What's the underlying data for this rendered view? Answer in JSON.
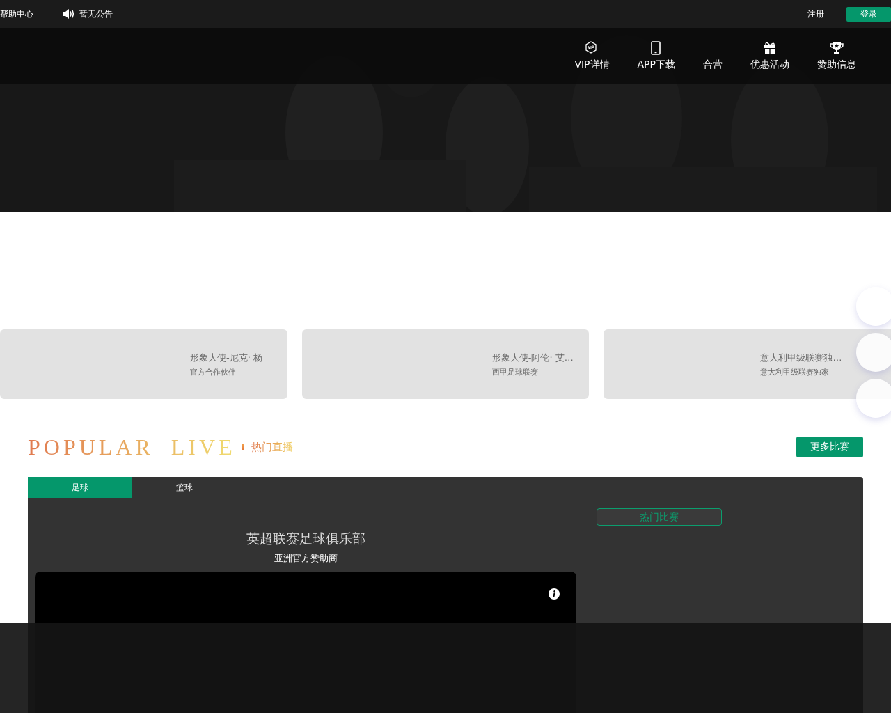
{
  "top_bar": {
    "help": "帮助中心",
    "notice": "暂无公告",
    "register": "注册",
    "login": "登录"
  },
  "nav": [
    {
      "label": "VIP详情"
    },
    {
      "label": "APP下载"
    },
    {
      "label": "合营"
    },
    {
      "label": "优惠活动"
    },
    {
      "label": "赞助信息"
    }
  ],
  "cards": [
    {
      "title": "形象大使-尼克· 杨",
      "subtitle": "官方合作伙伴"
    },
    {
      "title": "形象大使-阿伦· 艾…",
      "subtitle": "西甲足球联赛"
    },
    {
      "title": "意大利甲级联赛独…",
      "subtitle": "意大利甲级联赛独家"
    }
  ],
  "live": {
    "title_en": "POPULAR LIVE",
    "title_cn": "热门直播",
    "more": "更多比赛",
    "tabs": [
      {
        "label": "足球",
        "selected": true
      },
      {
        "label": "篮球",
        "selected": false
      }
    ],
    "headline": "英超联赛足球俱乐部",
    "subheadline": "亚洲官方赞助商",
    "hot_button": "热门比赛"
  }
}
